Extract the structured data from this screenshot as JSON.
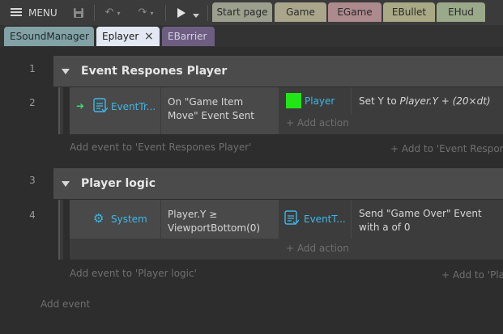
{
  "toolbar": {
    "menu_label": "MENU",
    "tabs_top": [
      {
        "label": "Start page",
        "color": "#9a9f8e"
      },
      {
        "label": "Game",
        "color": "#a9a68c"
      },
      {
        "label": "EGame",
        "color": "#ad8a8e"
      },
      {
        "label": "EBullet",
        "color": "#a9a985"
      },
      {
        "label": "EHud",
        "color": "#99a989"
      }
    ]
  },
  "tabs2": [
    {
      "label": "ESoundManager",
      "color": "#82a2a5"
    },
    {
      "label": "Eplayer",
      "color": "#e2e9f3",
      "close": "×"
    },
    {
      "label": "EBarrier",
      "color": "#6d5e81"
    }
  ],
  "groups": [
    {
      "row": "1",
      "title": "Event Respones Player",
      "event": {
        "row": "2",
        "trigger_object": "EventTr...",
        "condition": "On \"Game Item Move\" Event Sent",
        "action_object": "Player",
        "action_text_prefix": "Set Y to ",
        "action_text_expr": "Player.Y + (20×dt)",
        "add_action": "Add action"
      },
      "add_event": "Add event to 'Event Respones Player'",
      "add_to": "Add to 'Event Respon"
    },
    {
      "row": "3",
      "title": "Player logic",
      "event": {
        "row": "4",
        "trigger_object": "System",
        "condition": "Player.Y ≥ ViewportBottom(0)",
        "action_object": "EventT...",
        "action_text": "Send \"Game Over\" Event with a of 0",
        "add_action": "Add action"
      },
      "add_event": "Add event to 'Player logic'",
      "add_to": "Add to 'Pla"
    }
  ],
  "footer": {
    "add_event": "Add event"
  }
}
